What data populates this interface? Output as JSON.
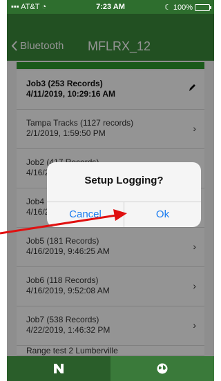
{
  "status_bar": {
    "carrier": "AT&T",
    "time": "7:23 AM",
    "battery": "100%"
  },
  "header": {
    "back_label": "Bluetooth",
    "title": "MFLRX_12"
  },
  "records": [
    {
      "line1": "Job3 (253 Records)",
      "line2": "4/11/2019, 10:29:16 AM",
      "selected": true
    },
    {
      "line1": "Tampa Tracks (1127 records)",
      "line2": "2/1/2019, 1:59:50 PM"
    },
    {
      "line1": "Job2 (417 Records)",
      "line2": "4/16/2019"
    },
    {
      "line1": "Job4",
      "line2": "4/16/2019"
    },
    {
      "line1": "Job5 (181 Records)",
      "line2": "4/16/2019, 9:46:25 AM"
    },
    {
      "line1": "Job6 (118 Records)",
      "line2": "4/16/2019, 9:52:08 AM"
    },
    {
      "line1": "Job7 (538 Records)",
      "line2": "4/22/2019, 1:46:32 PM"
    },
    {
      "line1": "Range test 2 Lumberville",
      "line2": ""
    }
  ],
  "fab_label": "+",
  "dialog": {
    "title": "Setup Logging?",
    "cancel": "Cancel",
    "ok": "Ok"
  },
  "tabs": [
    {
      "icon": "n-logo-icon",
      "active": true
    },
    {
      "icon": "globe-icon",
      "active": false
    }
  ],
  "colors": {
    "header_green": "#3b8a3b",
    "status_green": "#2e6e2e",
    "accent_green": "#2e9a2e",
    "fab_purple": "#b13aa6",
    "dialog_blue": "#1a7cf0",
    "annotation_red": "#e01010"
  }
}
